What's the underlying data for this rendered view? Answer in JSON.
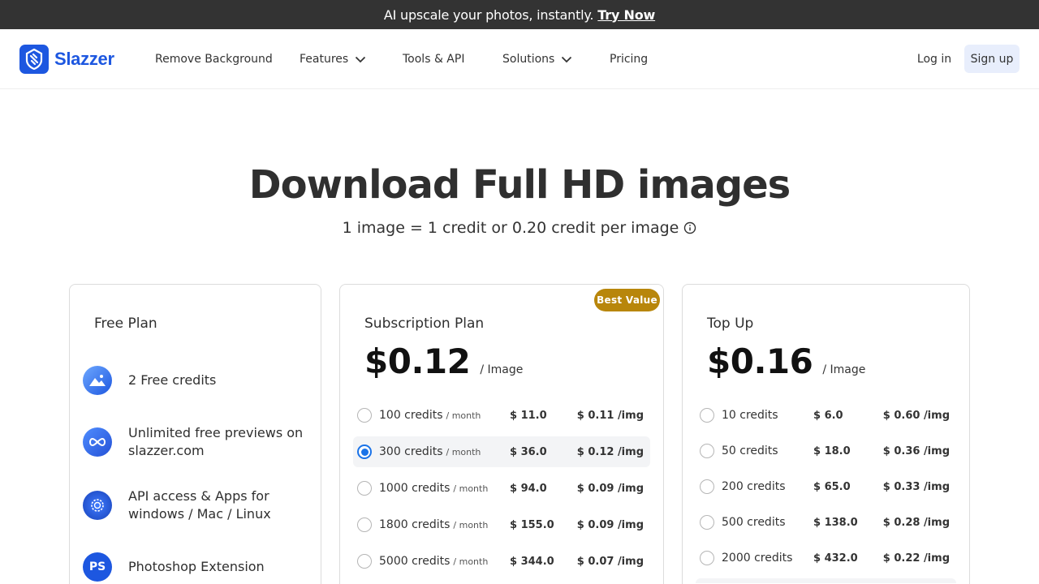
{
  "announcement": {
    "text": "AI upscale your photos, instantly.",
    "link": "Try Now"
  },
  "nav": {
    "brand": "Slazzer",
    "items": [
      "Remove Background",
      "Features",
      "Tools & API",
      "Solutions",
      "Pricing"
    ],
    "login": "Log in",
    "signup": "Sign up"
  },
  "hero": {
    "title": "Download Full HD images",
    "subtitle": "1 image = 1 credit or 0.20 credit per image"
  },
  "free_plan": {
    "title": "Free Plan",
    "features": [
      {
        "icon": "image-icon",
        "text": "2 Free credits"
      },
      {
        "icon": "infinity-icon",
        "text": "Unlimited free previews on slazzer.com"
      },
      {
        "icon": "api-gear-icon",
        "text": "API access & Apps for windows / Mac / Linux"
      },
      {
        "icon": "photoshop-icon",
        "text": "Photoshop Extension",
        "label": "PS"
      }
    ]
  },
  "subscription_plan": {
    "title": "Subscription Plan",
    "badge": "Best Value",
    "price": "$0.12",
    "per": "/ Image",
    "selected_index": 1,
    "rows": [
      {
        "credits": "100 credits",
        "period": "/ month",
        "cost": "$ 11.0",
        "unit": "$ 0.11 /img"
      },
      {
        "credits": "300 credits",
        "period": "/ month",
        "cost": "$ 36.0",
        "unit": "$ 0.12 /img"
      },
      {
        "credits": "1000 credits",
        "period": "/ month",
        "cost": "$ 94.0",
        "unit": "$ 0.09 /img"
      },
      {
        "credits": "1800 credits",
        "period": "/ month",
        "cost": "$ 155.0",
        "unit": "$ 0.09 /img"
      },
      {
        "credits": "5000 credits",
        "period": "/ month",
        "cost": "$ 344.0",
        "unit": "$ 0.07 /img"
      }
    ]
  },
  "top_up": {
    "title": "Top Up",
    "price": "$0.16",
    "per": "/ Image",
    "rows": [
      {
        "credits": "10 credits",
        "cost": "$ 6.0",
        "unit": "$ 0.60 /img"
      },
      {
        "credits": "50 credits",
        "cost": "$ 18.0",
        "unit": "$ 0.36 /img"
      },
      {
        "credits": "200 credits",
        "cost": "$ 65.0",
        "unit": "$ 0.33 /img"
      },
      {
        "credits": "500 credits",
        "cost": "$ 138.0",
        "unit": "$ 0.28 /img"
      },
      {
        "credits": "2000 credits",
        "cost": "$ 432.0",
        "unit": "$ 0.22 /img"
      }
    ]
  },
  "colors": {
    "brand": "#1d57e0",
    "badge": "#b8860b",
    "radio_selected": "#1a73e8"
  }
}
